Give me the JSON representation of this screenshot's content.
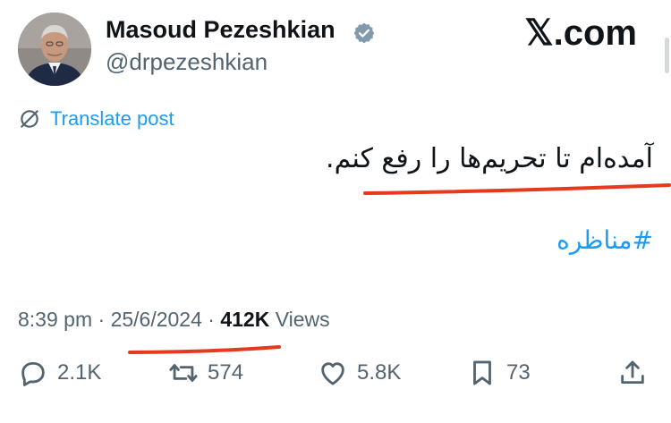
{
  "author": {
    "name": "Masoud Pezeshkian",
    "handle": "@drpezeshkian",
    "verified_icon": "verified-badge-icon"
  },
  "brand": {
    "label": "𝕏.com"
  },
  "translate": {
    "label": "Translate post",
    "icon": "translate-icon"
  },
  "post": {
    "text": "آمده‌ام تا تحریم‌ها را رفع کنم.",
    "hashtag": "#مناظره"
  },
  "meta": {
    "time": "8:39 pm",
    "separator": "·",
    "date": "25/6/2024",
    "views_count": "412K",
    "views_label": "Views"
  },
  "actions": {
    "replies": "2.1K",
    "reposts": "574",
    "likes": "5.8K",
    "bookmarks": "73"
  },
  "colors": {
    "link": "#1d9bf0",
    "secondary_text": "#536471",
    "primary_text": "#0f1419",
    "annotation_underline": "#e53a1f"
  }
}
